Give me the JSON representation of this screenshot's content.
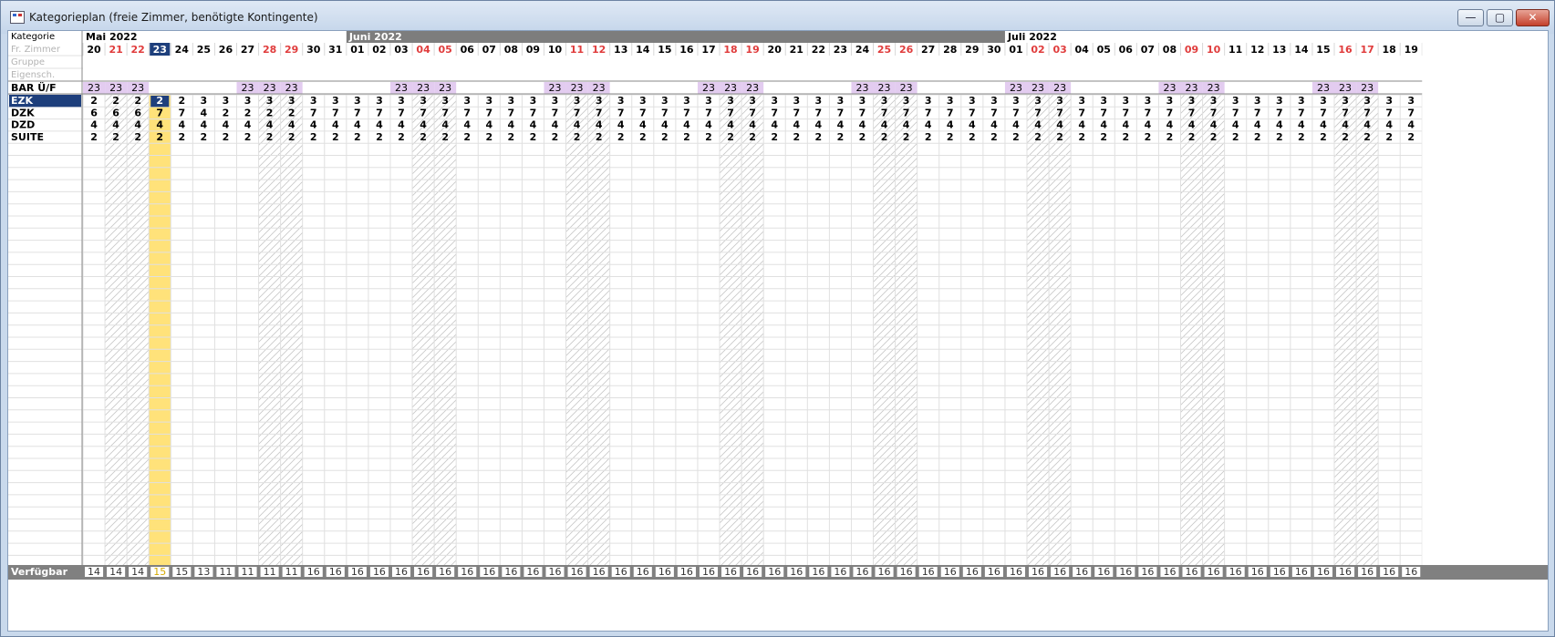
{
  "window": {
    "title": "Kategorieplan (freie Zimmer, benötigte Kontingente)",
    "minimize_glyph": "—",
    "maximize_glyph": "▢",
    "close_glyph": "✕"
  },
  "header_labels": [
    "Kategorie",
    "Fr. Zimmer",
    "Gruppe",
    "Eigensch."
  ],
  "months": [
    {
      "label": "Mai 2022",
      "start": 0,
      "span": 12,
      "active": false
    },
    {
      "label": "Juni 2022",
      "start": 12,
      "span": 30,
      "active": true
    },
    {
      "label": "Juli 2022",
      "start": 42,
      "span": 19,
      "active": false
    }
  ],
  "days": [
    "20",
    "21",
    "22",
    "23",
    "24",
    "25",
    "26",
    "27",
    "28",
    "29",
    "30",
    "31",
    "01",
    "02",
    "03",
    "04",
    "05",
    "06",
    "07",
    "08",
    "09",
    "10",
    "11",
    "12",
    "13",
    "14",
    "15",
    "16",
    "17",
    "18",
    "19",
    "20",
    "21",
    "22",
    "23",
    "24",
    "25",
    "26",
    "27",
    "28",
    "29",
    "30",
    "01",
    "02",
    "03",
    "04",
    "05",
    "06",
    "07",
    "08",
    "09",
    "10",
    "11",
    "12",
    "13",
    "14",
    "15",
    "16",
    "17",
    "18",
    "19"
  ],
  "weekend_indices": [
    1,
    2,
    8,
    9,
    15,
    16,
    22,
    23,
    29,
    30,
    36,
    37,
    43,
    44,
    50,
    51,
    57,
    58
  ],
  "today_index": 3,
  "bar_row": {
    "label": "BAR Ü/F",
    "values": [
      "23",
      "23",
      "23",
      "",
      "",
      "",
      "",
      "23",
      "23",
      "23",
      "",
      "",
      "",
      "",
      "23",
      "23",
      "23",
      "",
      "",
      "",
      "",
      "23",
      "23",
      "23",
      "",
      "",
      "",
      "",
      "23",
      "23",
      "23",
      "",
      "",
      "",
      "",
      "23",
      "23",
      "23",
      "",
      "",
      "",
      "",
      "23",
      "23",
      "23",
      "",
      "",
      "",
      "",
      "23",
      "23",
      "23",
      "",
      "",
      "",
      "",
      "23",
      "23",
      "23",
      "",
      ""
    ]
  },
  "categories": [
    {
      "label": "EZK",
      "selected": true,
      "values": [
        "2",
        "2",
        "2",
        "2",
        "2",
        "3",
        "3",
        "3",
        "3",
        "3",
        "3",
        "3",
        "3",
        "3",
        "3",
        "3",
        "3",
        "3",
        "3",
        "3",
        "3",
        "3",
        "3",
        "3",
        "3",
        "3",
        "3",
        "3",
        "3",
        "3",
        "3",
        "3",
        "3",
        "3",
        "3",
        "3",
        "3",
        "3",
        "3",
        "3",
        "3",
        "3",
        "3",
        "3",
        "3",
        "3",
        "3",
        "3",
        "3",
        "3",
        "3",
        "3",
        "3",
        "3",
        "3",
        "3",
        "3",
        "3",
        "3",
        "3",
        "3"
      ]
    },
    {
      "label": "DZK",
      "selected": false,
      "values": [
        "6",
        "6",
        "6",
        "7",
        "7",
        "4",
        "2",
        "2",
        "2",
        "2",
        "7",
        "7",
        "7",
        "7",
        "7",
        "7",
        "7",
        "7",
        "7",
        "7",
        "7",
        "7",
        "7",
        "7",
        "7",
        "7",
        "7",
        "7",
        "7",
        "7",
        "7",
        "7",
        "7",
        "7",
        "7",
        "7",
        "7",
        "7",
        "7",
        "7",
        "7",
        "7",
        "7",
        "7",
        "7",
        "7",
        "7",
        "7",
        "7",
        "7",
        "7",
        "7",
        "7",
        "7",
        "7",
        "7",
        "7",
        "7",
        "7",
        "7",
        "7"
      ]
    },
    {
      "label": "DZD",
      "selected": false,
      "values": [
        "4",
        "4",
        "4",
        "4",
        "4",
        "4",
        "4",
        "4",
        "4",
        "4",
        "4",
        "4",
        "4",
        "4",
        "4",
        "4",
        "4",
        "4",
        "4",
        "4",
        "4",
        "4",
        "4",
        "4",
        "4",
        "4",
        "4",
        "4",
        "4",
        "4",
        "4",
        "4",
        "4",
        "4",
        "4",
        "4",
        "4",
        "4",
        "4",
        "4",
        "4",
        "4",
        "4",
        "4",
        "4",
        "4",
        "4",
        "4",
        "4",
        "4",
        "4",
        "4",
        "4",
        "4",
        "4",
        "4",
        "4",
        "4",
        "4",
        "4",
        "4"
      ]
    },
    {
      "label": "SUITE",
      "selected": false,
      "values": [
        "2",
        "2",
        "2",
        "2",
        "2",
        "2",
        "2",
        "2",
        "2",
        "2",
        "2",
        "2",
        "2",
        "2",
        "2",
        "2",
        "2",
        "2",
        "2",
        "2",
        "2",
        "2",
        "2",
        "2",
        "2",
        "2",
        "2",
        "2",
        "2",
        "2",
        "2",
        "2",
        "2",
        "2",
        "2",
        "2",
        "2",
        "2",
        "2",
        "2",
        "2",
        "2",
        "2",
        "2",
        "2",
        "2",
        "2",
        "2",
        "2",
        "2",
        "2",
        "2",
        "2",
        "2",
        "2",
        "2",
        "2",
        "2",
        "2",
        "2",
        "2"
      ]
    }
  ],
  "footer": {
    "label": "Verfügbar",
    "values": [
      "14",
      "14",
      "14",
      "15",
      "15",
      "13",
      "11",
      "11",
      "11",
      "11",
      "16",
      "16",
      "16",
      "16",
      "16",
      "16",
      "16",
      "16",
      "16",
      "16",
      "16",
      "16",
      "16",
      "16",
      "16",
      "16",
      "16",
      "16",
      "16",
      "16",
      "16",
      "16",
      "16",
      "16",
      "16",
      "16",
      "16",
      "16",
      "16",
      "16",
      "16",
      "16",
      "16",
      "16",
      "16",
      "16",
      "16",
      "16",
      "16",
      "16",
      "16",
      "16",
      "16",
      "16",
      "16",
      "16",
      "16",
      "16",
      "16",
      "16",
      "16"
    ]
  },
  "colors": {
    "weekend_text": "#e03c3c",
    "today_bg": "#1e3f7c",
    "today_col": "#ffe27a",
    "bar_bg": "#e3ccf0",
    "month_active": "#7d7d7d",
    "footer_bg": "#808080",
    "grid_line": "#e0e0e0",
    "hatch": "#c8c8c8",
    "label_muted": "#b4b4b4"
  }
}
